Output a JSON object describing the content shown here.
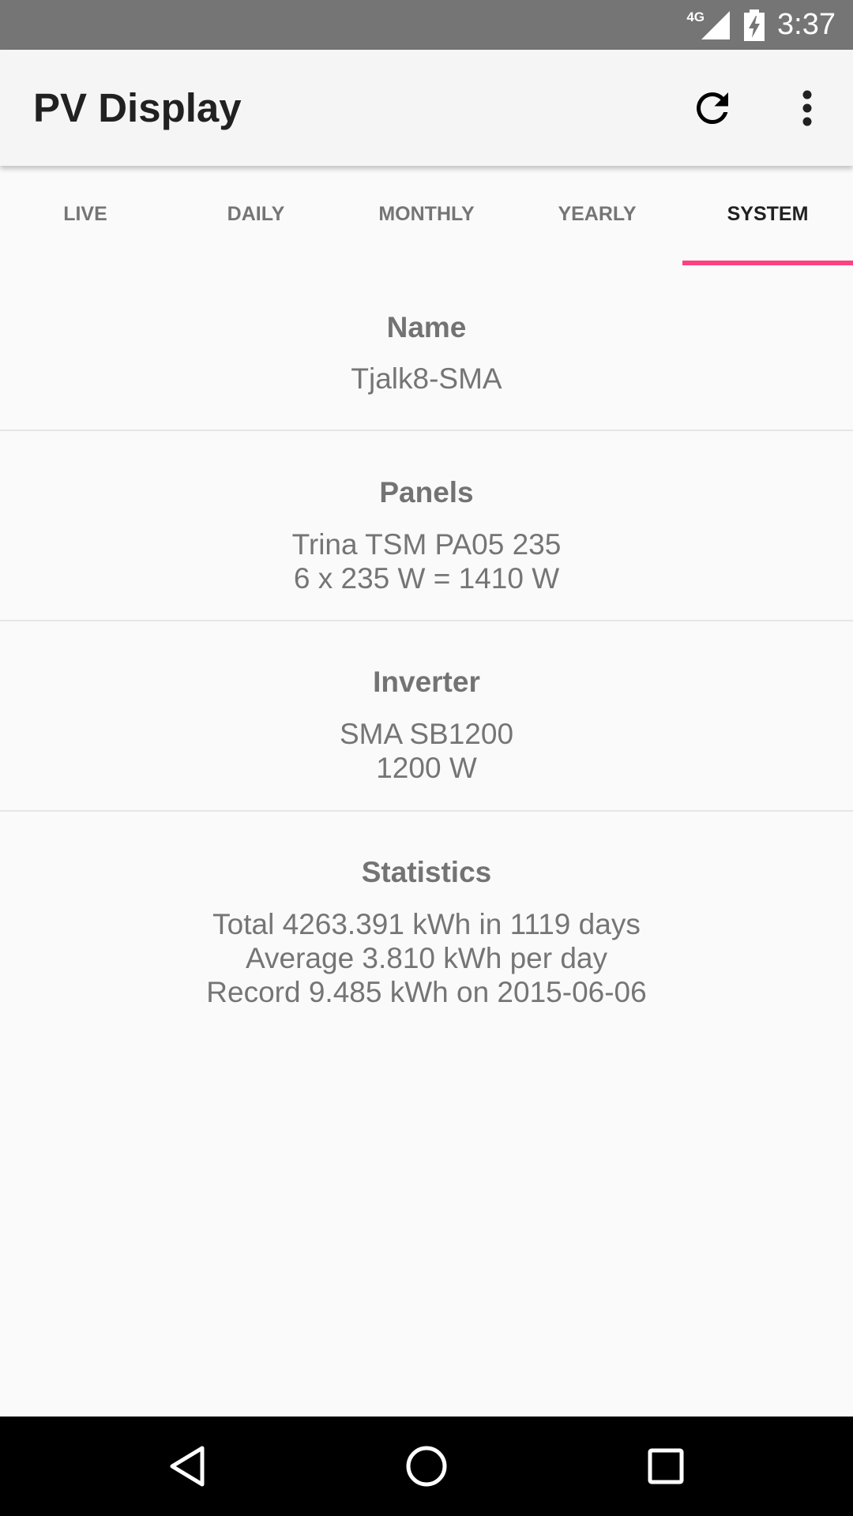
{
  "status_bar": {
    "network": "4G",
    "time": "3:37",
    "icons": [
      "signal-icon",
      "battery-charging-icon"
    ]
  },
  "toolbar": {
    "title": "PV Display",
    "refresh_icon": "refresh-icon",
    "overflow_icon": "more-vert-icon"
  },
  "tabs": [
    {
      "label": "LIVE",
      "active": false
    },
    {
      "label": "DAILY",
      "active": false
    },
    {
      "label": "MONTHLY",
      "active": false
    },
    {
      "label": "YEARLY",
      "active": false
    },
    {
      "label": "SYSTEM",
      "active": true
    }
  ],
  "colors": {
    "accent": "#ff4081",
    "status_bar": "#757575",
    "toolbar": "#f5f5f5",
    "background": "#fafafa",
    "text_primary": "#212121",
    "text_secondary": "#757575"
  },
  "sections": {
    "name": {
      "title": "Name",
      "lines": [
        "Tjalk8-SMA"
      ]
    },
    "panels": {
      "title": "Panels",
      "lines": [
        "Trina TSM PA05 235",
        "6 x 235 W = 1410 W"
      ]
    },
    "inverter": {
      "title": "Inverter",
      "lines": [
        "SMA SB1200",
        "1200 W"
      ]
    },
    "statistics": {
      "title": "Statistics",
      "lines": [
        "Total 4263.391 kWh in 1119 days",
        "Average 3.810 kWh per day",
        "Record 9.485 kWh on 2015-06-06"
      ]
    }
  },
  "nav_bar": {
    "icons": [
      "back-icon",
      "home-icon",
      "recents-icon"
    ]
  }
}
